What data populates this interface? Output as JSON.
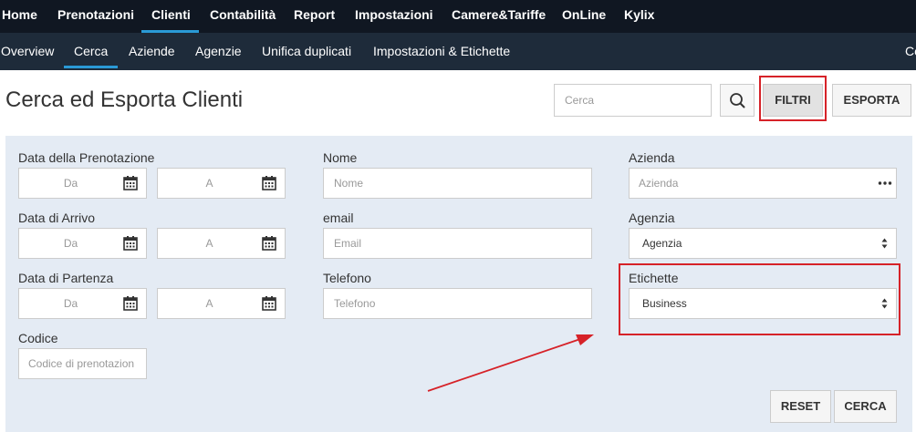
{
  "top_nav": {
    "items": [
      "Home",
      "Prenotazioni",
      "Clienti",
      "Contabilità",
      "Report",
      "Impostazioni",
      "Camere&Tariffe",
      "OnLine",
      "Kylix"
    ],
    "active": "Clienti"
  },
  "sub_nav": {
    "items": [
      "Overview",
      "Cerca",
      "Aziende",
      "Agenzie",
      "Unifica duplicati",
      "Impostazioni & Etichette"
    ],
    "active": "Cerca",
    "overflow_text": "Ce"
  },
  "header": {
    "title": "Cerca ed Esporta Clienti",
    "search_placeholder": "Cerca",
    "filtri_label": "FILTRI",
    "esporta_label": "ESPORTA"
  },
  "filters": {
    "data_prenotazione": {
      "label": "Data della Prenotazione",
      "from_placeholder": "Da",
      "to_placeholder": "A"
    },
    "data_arrivo": {
      "label": "Data di Arrivo",
      "from_placeholder": "Da",
      "to_placeholder": "A"
    },
    "data_partenza": {
      "label": "Data di Partenza",
      "from_placeholder": "Da",
      "to_placeholder": "A"
    },
    "codice": {
      "label": "Codice",
      "placeholder": "Codice di prenotazion"
    },
    "nome": {
      "label": "Nome",
      "placeholder": "Nome"
    },
    "email": {
      "label": "email",
      "placeholder": "Email"
    },
    "telefono": {
      "label": "Telefono",
      "placeholder": "Telefono"
    },
    "azienda": {
      "label": "Azienda",
      "placeholder": "Azienda"
    },
    "agenzia": {
      "label": "Agenzia",
      "value": "Agenzia"
    },
    "etichette": {
      "label": "Etichette",
      "value": "Business"
    },
    "reset_label": "RESET",
    "cerca_label": "CERCA"
  },
  "colors": {
    "top_nav_bg": "#101722",
    "sub_nav_bg": "#1e2b3a",
    "accent": "#2a9ad6",
    "panel_bg": "#e4ebf4",
    "annotation_red": "#d62228"
  }
}
